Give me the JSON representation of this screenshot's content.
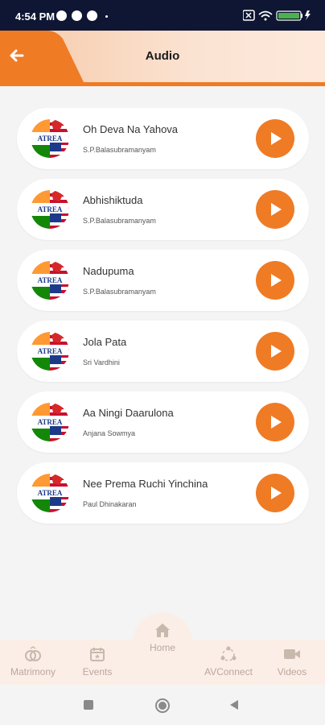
{
  "status": {
    "time": "4:54 PM",
    "battery": "100"
  },
  "header": {
    "title": "Audio"
  },
  "songs": [
    {
      "title": "Oh Deva Na Yahova",
      "artist": "S.P.Balasubramanyam"
    },
    {
      "title": "Abhishiktuda",
      "artist": "S.P.Balasubramanyam"
    },
    {
      "title": "Nadupuma",
      "artist": "S.P.Balasubramanyam"
    },
    {
      "title": "Jola Pata",
      "artist": "Sri Vardhini"
    },
    {
      "title": "Aa Ningi Daarulona",
      "artist": "Anjana Sowmya"
    },
    {
      "title": "Nee Prema Ruchi Yinchina",
      "artist": "Paul Dhinakaran"
    }
  ],
  "logo_text": "ATREA",
  "nav": {
    "matrimony": "Matrimony",
    "events": "Events",
    "home": "Home",
    "avconnect": "AVConnect",
    "videos": "Videos"
  },
  "colors": {
    "accent": "#ef7b25",
    "status_bar": "#0f1633"
  }
}
